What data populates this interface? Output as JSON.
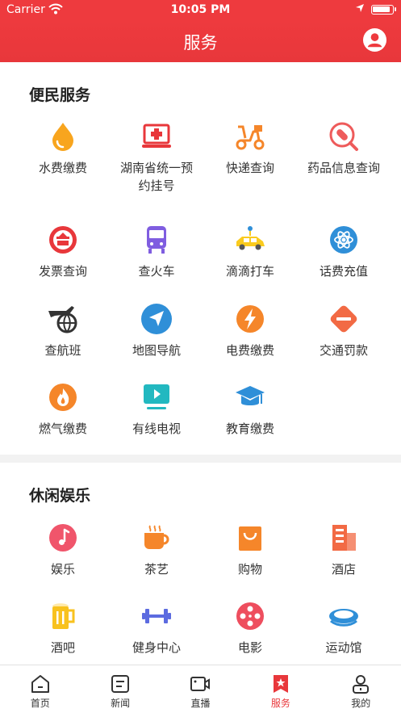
{
  "status_bar": {
    "carrier": "Carrier",
    "time": "10:05 PM"
  },
  "header": {
    "title": "服务"
  },
  "convenience": {
    "title": "便民服务",
    "items": [
      {
        "label": "水费缴费",
        "icon": "water-drop-icon"
      },
      {
        "label": "湖南省统一预约挂号",
        "icon": "medical-monitor-icon"
      },
      {
        "label": "快递查询",
        "icon": "delivery-scooter-icon"
      },
      {
        "label": "药品信息查询",
        "icon": "pill-search-icon"
      },
      {
        "label": "发票查询",
        "icon": "tax-emblem-icon"
      },
      {
        "label": "查火车",
        "icon": "train-icon"
      },
      {
        "label": "滴滴打车",
        "icon": "taxi-icon"
      },
      {
        "label": "话费充值",
        "icon": "atom-icon"
      },
      {
        "label": "查航班",
        "icon": "flight-globe-icon"
      },
      {
        "label": "地图导航",
        "icon": "navigation-arrow-icon"
      },
      {
        "label": "电费缴费",
        "icon": "lightning-icon"
      },
      {
        "label": "交通罚款",
        "icon": "no-entry-icon"
      },
      {
        "label": "燃气缴费",
        "icon": "flame-icon"
      },
      {
        "label": "有线电视",
        "icon": "tv-play-icon"
      },
      {
        "label": "教育缴费",
        "icon": "graduation-cap-icon"
      }
    ]
  },
  "leisure": {
    "title": "休闲娱乐",
    "items": [
      {
        "label": "娱乐",
        "icon": "music-note-icon"
      },
      {
        "label": "茶艺",
        "icon": "tea-cup-icon"
      },
      {
        "label": "购物",
        "icon": "shopping-bag-icon"
      },
      {
        "label": "酒店",
        "icon": "hotel-building-icon"
      },
      {
        "label": "酒吧",
        "icon": "beer-mug-icon"
      },
      {
        "label": "健身中心",
        "icon": "dumbbell-icon"
      },
      {
        "label": "电影",
        "icon": "film-reel-icon"
      },
      {
        "label": "运动馆",
        "icon": "stadium-icon"
      }
    ]
  },
  "tabbar": {
    "items": [
      {
        "label": "首页",
        "icon": "home-icon"
      },
      {
        "label": "新闻",
        "icon": "news-icon"
      },
      {
        "label": "直播",
        "icon": "video-camera-icon"
      },
      {
        "label": "服务",
        "icon": "service-bookmark-icon",
        "active": true
      },
      {
        "label": "我的",
        "icon": "profile-icon"
      }
    ]
  },
  "colors": {
    "brand": "#E8373B",
    "orange": "#F5862A",
    "blue": "#2F8FD8"
  }
}
